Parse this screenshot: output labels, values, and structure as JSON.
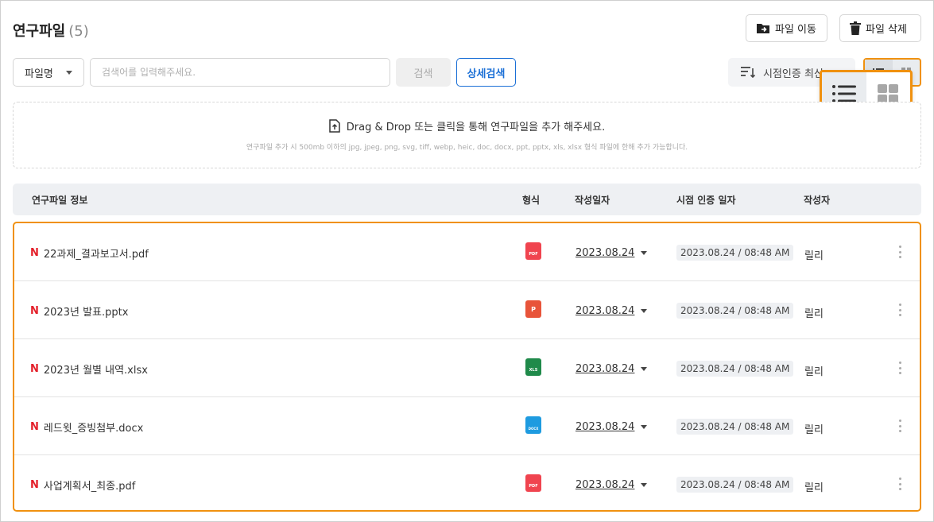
{
  "header": {
    "title": "연구파일",
    "count": "(5)",
    "move_label": "파일 이동",
    "delete_label": "파일 삭제"
  },
  "search": {
    "select_value": "파일명",
    "placeholder": "검색어를 입력해주세요.",
    "search_label": "검색",
    "detail_label": "상세검색"
  },
  "sort": {
    "label": "시점인증 최신",
    "icon": "sort-icon"
  },
  "view_toggle": {
    "options": [
      "list-icon",
      "grid-icon"
    ],
    "active": "list"
  },
  "dropzone": {
    "main": "Drag & Drop 또는 클릭을 통해 연구파일을 추가 해주세요.",
    "hint": "연구파일 추가 시 500mb 이하의 jpg, jpeg, png, svg, tiff, webp, heic, doc, docx, ppt, pptx, xls, xlsx 형식 파일에 한해 추가 가능합니다."
  },
  "table": {
    "columns": [
      "연구파일 정보",
      "형식",
      "작성일자",
      "시점 인증 일자",
      "작성자"
    ],
    "rows": [
      {
        "new": "N",
        "name": "22과제_결과보고서.pdf",
        "type": "PDF",
        "type_color": "#f0444f",
        "date": "2023.08.24",
        "cert": "2023.08.24 / 08:48 AM",
        "author": "릴리"
      },
      {
        "new": "N",
        "name": "2023년 발표.pptx",
        "type": "P",
        "type_color": "#e8543a",
        "date": "2023.08.24",
        "cert": "2023.08.24 / 08:48 AM",
        "author": "릴리"
      },
      {
        "new": "N",
        "name": "2023년 월별 내역.xlsx",
        "type": "XLS",
        "type_color": "#1f8a4a",
        "date": "2023.08.24",
        "cert": "2023.08.24 / 08:48 AM",
        "author": "릴리"
      },
      {
        "new": "N",
        "name": "레드윗_증빙첨부.docx",
        "type": "DOCX",
        "type_color": "#1e9be0",
        "date": "2023.08.24",
        "cert": "2023.08.24 / 08:48 AM",
        "author": "릴리"
      },
      {
        "new": "N",
        "name": "사업계획서_최종.pdf",
        "type": "PDF",
        "type_color": "#f0444f",
        "date": "2023.08.24",
        "cert": "2023.08.24 / 08:48 AM",
        "author": "릴리"
      }
    ]
  },
  "colors": {
    "accent": "#1a6fd6",
    "highlight": "#f0910f",
    "new_mark": "#e4202a"
  }
}
